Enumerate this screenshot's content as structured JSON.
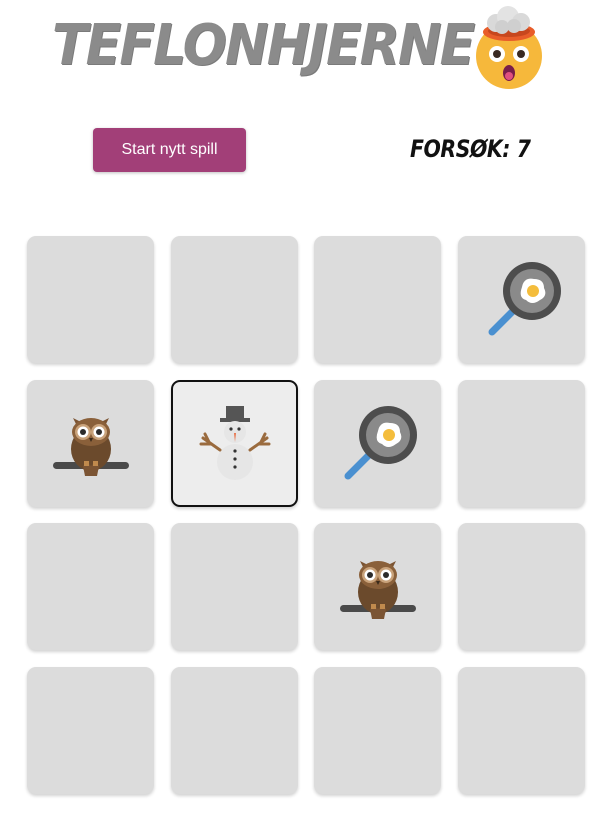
{
  "header": {
    "title": "TEFLONHJERNE",
    "logo_icon": "mind-blown-emoji-icon"
  },
  "controls": {
    "new_game_label": "Start nytt spill",
    "attempts_label": "FORSØK:",
    "attempts_value": "7"
  },
  "colors": {
    "button": "#a23f78",
    "card_face_down": "#dcdcdc",
    "card_selected": "#ededed",
    "title": "#8b8b8b"
  },
  "board": {
    "rows": 4,
    "columns": 4,
    "cards": [
      {
        "state": "hidden",
        "icon": ""
      },
      {
        "state": "hidden",
        "icon": ""
      },
      {
        "state": "hidden",
        "icon": ""
      },
      {
        "state": "revealed",
        "icon": "frying-pan-icon"
      },
      {
        "state": "revealed",
        "icon": "owl-icon"
      },
      {
        "state": "selected",
        "icon": "snowman-icon"
      },
      {
        "state": "revealed",
        "icon": "frying-pan-icon"
      },
      {
        "state": "hidden",
        "icon": ""
      },
      {
        "state": "hidden",
        "icon": ""
      },
      {
        "state": "hidden",
        "icon": ""
      },
      {
        "state": "revealed",
        "icon": "owl-icon"
      },
      {
        "state": "hidden",
        "icon": ""
      },
      {
        "state": "hidden",
        "icon": ""
      },
      {
        "state": "hidden",
        "icon": ""
      },
      {
        "state": "hidden",
        "icon": ""
      },
      {
        "state": "hidden",
        "icon": ""
      }
    ]
  }
}
